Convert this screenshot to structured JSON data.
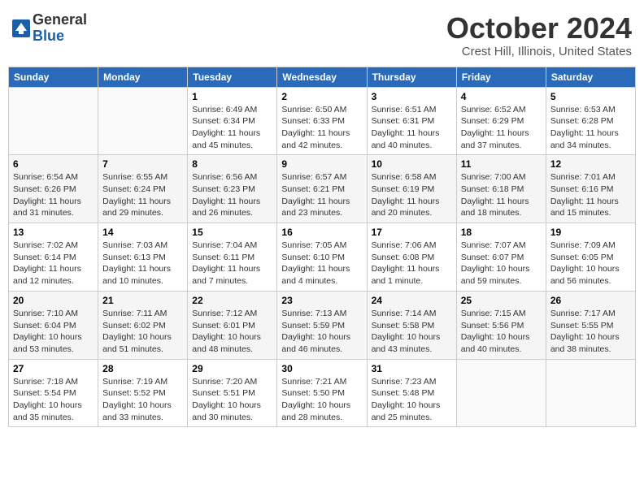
{
  "header": {
    "logo_general": "General",
    "logo_blue": "Blue",
    "title": "October 2024",
    "location": "Crest Hill, Illinois, United States"
  },
  "weekdays": [
    "Sunday",
    "Monday",
    "Tuesday",
    "Wednesday",
    "Thursday",
    "Friday",
    "Saturday"
  ],
  "weeks": [
    [
      {
        "day": "",
        "sunrise": "",
        "sunset": "",
        "daylight": ""
      },
      {
        "day": "",
        "sunrise": "",
        "sunset": "",
        "daylight": ""
      },
      {
        "day": "1",
        "sunrise": "Sunrise: 6:49 AM",
        "sunset": "Sunset: 6:34 PM",
        "daylight": "Daylight: 11 hours and 45 minutes."
      },
      {
        "day": "2",
        "sunrise": "Sunrise: 6:50 AM",
        "sunset": "Sunset: 6:33 PM",
        "daylight": "Daylight: 11 hours and 42 minutes."
      },
      {
        "day": "3",
        "sunrise": "Sunrise: 6:51 AM",
        "sunset": "Sunset: 6:31 PM",
        "daylight": "Daylight: 11 hours and 40 minutes."
      },
      {
        "day": "4",
        "sunrise": "Sunrise: 6:52 AM",
        "sunset": "Sunset: 6:29 PM",
        "daylight": "Daylight: 11 hours and 37 minutes."
      },
      {
        "day": "5",
        "sunrise": "Sunrise: 6:53 AM",
        "sunset": "Sunset: 6:28 PM",
        "daylight": "Daylight: 11 hours and 34 minutes."
      }
    ],
    [
      {
        "day": "6",
        "sunrise": "Sunrise: 6:54 AM",
        "sunset": "Sunset: 6:26 PM",
        "daylight": "Daylight: 11 hours and 31 minutes."
      },
      {
        "day": "7",
        "sunrise": "Sunrise: 6:55 AM",
        "sunset": "Sunset: 6:24 PM",
        "daylight": "Daylight: 11 hours and 29 minutes."
      },
      {
        "day": "8",
        "sunrise": "Sunrise: 6:56 AM",
        "sunset": "Sunset: 6:23 PM",
        "daylight": "Daylight: 11 hours and 26 minutes."
      },
      {
        "day": "9",
        "sunrise": "Sunrise: 6:57 AM",
        "sunset": "Sunset: 6:21 PM",
        "daylight": "Daylight: 11 hours and 23 minutes."
      },
      {
        "day": "10",
        "sunrise": "Sunrise: 6:58 AM",
        "sunset": "Sunset: 6:19 PM",
        "daylight": "Daylight: 11 hours and 20 minutes."
      },
      {
        "day": "11",
        "sunrise": "Sunrise: 7:00 AM",
        "sunset": "Sunset: 6:18 PM",
        "daylight": "Daylight: 11 hours and 18 minutes."
      },
      {
        "day": "12",
        "sunrise": "Sunrise: 7:01 AM",
        "sunset": "Sunset: 6:16 PM",
        "daylight": "Daylight: 11 hours and 15 minutes."
      }
    ],
    [
      {
        "day": "13",
        "sunrise": "Sunrise: 7:02 AM",
        "sunset": "Sunset: 6:14 PM",
        "daylight": "Daylight: 11 hours and 12 minutes."
      },
      {
        "day": "14",
        "sunrise": "Sunrise: 7:03 AM",
        "sunset": "Sunset: 6:13 PM",
        "daylight": "Daylight: 11 hours and 10 minutes."
      },
      {
        "day": "15",
        "sunrise": "Sunrise: 7:04 AM",
        "sunset": "Sunset: 6:11 PM",
        "daylight": "Daylight: 11 hours and 7 minutes."
      },
      {
        "day": "16",
        "sunrise": "Sunrise: 7:05 AM",
        "sunset": "Sunset: 6:10 PM",
        "daylight": "Daylight: 11 hours and 4 minutes."
      },
      {
        "day": "17",
        "sunrise": "Sunrise: 7:06 AM",
        "sunset": "Sunset: 6:08 PM",
        "daylight": "Daylight: 11 hours and 1 minute."
      },
      {
        "day": "18",
        "sunrise": "Sunrise: 7:07 AM",
        "sunset": "Sunset: 6:07 PM",
        "daylight": "Daylight: 10 hours and 59 minutes."
      },
      {
        "day": "19",
        "sunrise": "Sunrise: 7:09 AM",
        "sunset": "Sunset: 6:05 PM",
        "daylight": "Daylight: 10 hours and 56 minutes."
      }
    ],
    [
      {
        "day": "20",
        "sunrise": "Sunrise: 7:10 AM",
        "sunset": "Sunset: 6:04 PM",
        "daylight": "Daylight: 10 hours and 53 minutes."
      },
      {
        "day": "21",
        "sunrise": "Sunrise: 7:11 AM",
        "sunset": "Sunset: 6:02 PM",
        "daylight": "Daylight: 10 hours and 51 minutes."
      },
      {
        "day": "22",
        "sunrise": "Sunrise: 7:12 AM",
        "sunset": "Sunset: 6:01 PM",
        "daylight": "Daylight: 10 hours and 48 minutes."
      },
      {
        "day": "23",
        "sunrise": "Sunrise: 7:13 AM",
        "sunset": "Sunset: 5:59 PM",
        "daylight": "Daylight: 10 hours and 46 minutes."
      },
      {
        "day": "24",
        "sunrise": "Sunrise: 7:14 AM",
        "sunset": "Sunset: 5:58 PM",
        "daylight": "Daylight: 10 hours and 43 minutes."
      },
      {
        "day": "25",
        "sunrise": "Sunrise: 7:15 AM",
        "sunset": "Sunset: 5:56 PM",
        "daylight": "Daylight: 10 hours and 40 minutes."
      },
      {
        "day": "26",
        "sunrise": "Sunrise: 7:17 AM",
        "sunset": "Sunset: 5:55 PM",
        "daylight": "Daylight: 10 hours and 38 minutes."
      }
    ],
    [
      {
        "day": "27",
        "sunrise": "Sunrise: 7:18 AM",
        "sunset": "Sunset: 5:54 PM",
        "daylight": "Daylight: 10 hours and 35 minutes."
      },
      {
        "day": "28",
        "sunrise": "Sunrise: 7:19 AM",
        "sunset": "Sunset: 5:52 PM",
        "daylight": "Daylight: 10 hours and 33 minutes."
      },
      {
        "day": "29",
        "sunrise": "Sunrise: 7:20 AM",
        "sunset": "Sunset: 5:51 PM",
        "daylight": "Daylight: 10 hours and 30 minutes."
      },
      {
        "day": "30",
        "sunrise": "Sunrise: 7:21 AM",
        "sunset": "Sunset: 5:50 PM",
        "daylight": "Daylight: 10 hours and 28 minutes."
      },
      {
        "day": "31",
        "sunrise": "Sunrise: 7:23 AM",
        "sunset": "Sunset: 5:48 PM",
        "daylight": "Daylight: 10 hours and 25 minutes."
      },
      {
        "day": "",
        "sunrise": "",
        "sunset": "",
        "daylight": ""
      },
      {
        "day": "",
        "sunrise": "",
        "sunset": "",
        "daylight": ""
      }
    ]
  ]
}
